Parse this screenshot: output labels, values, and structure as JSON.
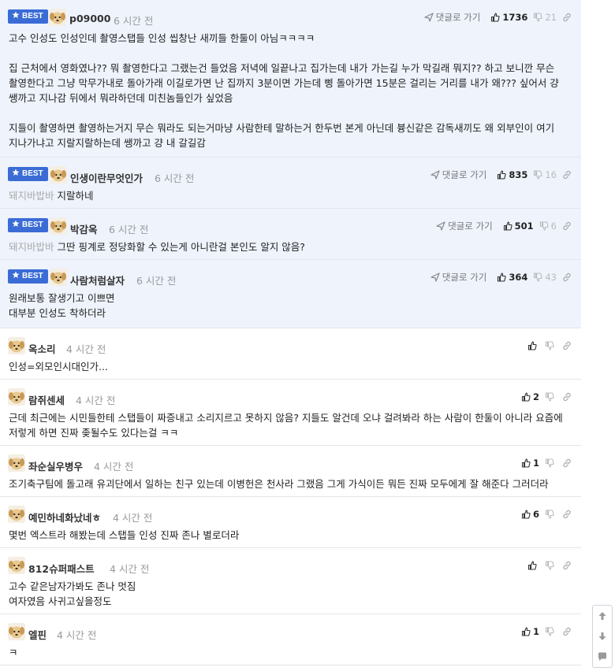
{
  "best_label": "BEST",
  "reply_label": "댓글로 가기",
  "comments": [
    {
      "best": true,
      "nick": "p09000",
      "time": "6 시간 전",
      "up": "1736",
      "down": "21",
      "reply_to": "",
      "paragraphs": [
        "고수 인성도 인성인데 촬영스탭들 인성 씹창난 새끼들 한둘이 아님ㅋㅋㅋㅋ",
        "집 근처에서 영화였나?? 뭐 촬영한다고 그랬는건 들었음 저녁에 일끝나고 집가는데 내가 가는길 누가 막길래 뭐지?? 하고 보니깐 무슨\n촬영한다고 그냥 막무가내로 돌아가래 이길로가면 난 집까지 3분이면 가는데 삥 돌아가면 15분은 걸리는 거리를 내가 왜??? 싶어서 걍\n쌩까고 지나감 뒤에서 뭐라하던데 미친놈들인가 싶었음",
        "지들이 촬영하면 촬영하는거지 무슨 뭐라도 되는거마냥 사람한테 말하는거 한두번 본게 아닌데 븅신같은 감독새끼도 왜 외부인이 여기\n지나가냐고 지랄지랄하는데 쌩까고 걍 내 갈길감"
      ]
    },
    {
      "best": true,
      "nick": "인생이란무엇인가",
      "time": "6 시간 전",
      "up": "835",
      "down": "16",
      "reply_to": "돼지바밥바",
      "paragraphs": [
        "지랄하네"
      ]
    },
    {
      "best": true,
      "nick": "박감옥",
      "time": "6 시간 전",
      "up": "501",
      "down": "6",
      "reply_to": "돼지바밥바",
      "paragraphs": [
        "그딴 핑계로 정당화할 수 있는게 아니란걸 본인도 알지 않음?"
      ]
    },
    {
      "best": true,
      "nick": "사람처럼살자",
      "time": "6 시간 전",
      "up": "364",
      "down": "43",
      "reply_to": "",
      "paragraphs": [
        "원래보통 잘생기고 이쁘면\n대부분 인성도 착하더라"
      ]
    },
    {
      "best": false,
      "nick": "옥소리",
      "time": "4 시간 전",
      "up": "",
      "down": "",
      "reply_to": "",
      "paragraphs": [
        "인성=외모인시대인가..."
      ]
    },
    {
      "best": false,
      "nick": "람쥐센세",
      "time": "4 시간 전",
      "up": "2",
      "down": "",
      "reply_to": "",
      "paragraphs": [
        "근데 최근에는 시민들한테 스탭들이 짜증내고 소리지르고 못하지 않음? 지들도 알건데 오냐 걸려봐라 하는 사람이 한둘이 아니라 요즘에\n저렇게 하면 진짜 좆될수도 있다는걸 ㅋㅋ"
      ]
    },
    {
      "best": false,
      "nick": "좌순실우병우",
      "time": "4 시간 전",
      "up": "1",
      "down": "",
      "reply_to": "",
      "paragraphs": [
        "조기축구팀에 돌고래 유괴단에서 일하는 친구 있는데 이병헌은 천사라 그랬음 그게 가식이든 뭐든 진짜 모두에게 잘 해준다 그러더라"
      ]
    },
    {
      "best": false,
      "nick": "예민하네화났네ㅎ",
      "time": "4 시간 전",
      "up": "6",
      "down": "",
      "reply_to": "",
      "paragraphs": [
        "몇번 엑스트라 해봤는데 스탭들 인성 진짜 존나 별로더라"
      ]
    },
    {
      "best": false,
      "nick": "812슈퍼패스트",
      "time": "4 시간 전",
      "up": "",
      "down": "",
      "reply_to": "",
      "paragraphs": [
        "고수 같은남자가봐도 존나 멋짐\n여자였음 사귀고싶을정도"
      ]
    },
    {
      "best": false,
      "nick": "엘핀",
      "time": "4 시간 전",
      "up": "1",
      "down": "",
      "reply_to": "",
      "paragraphs": [
        "ㅋ"
      ]
    }
  ],
  "colors": {
    "best_bg": "#eef3fc",
    "badge": "#3b6cd6",
    "border": "#e3e6ea",
    "muted": "#999999"
  },
  "icons": {
    "badge": "star-icon",
    "reply": "reply-arrow-icon",
    "up": "thumbs-up-icon",
    "down": "thumbs-down-icon",
    "link": "link-icon",
    "scroll_top": "arrow-up-icon",
    "scroll_bottom": "arrow-down-icon",
    "chat": "chat-bubble-icon"
  }
}
